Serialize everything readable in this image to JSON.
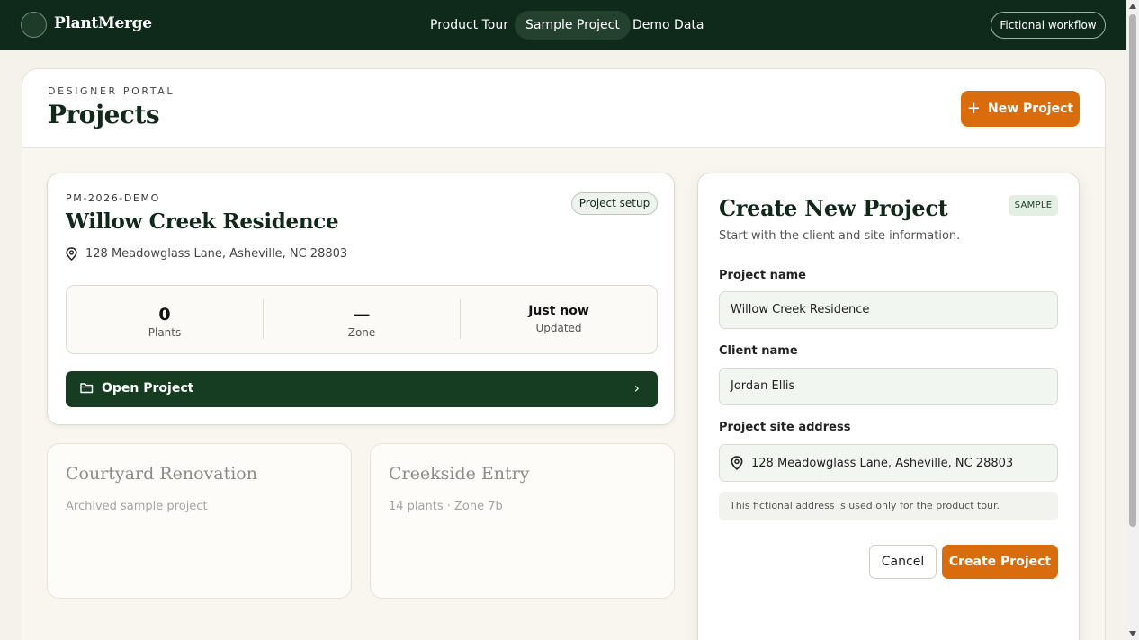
{
  "app": {
    "name": "PlantMerge",
    "nav": [
      "Product Tour",
      "Sample Project",
      "Demo Data"
    ],
    "active_nav": "Sample Project",
    "workflow_label": "Fictional workflow"
  },
  "header": {
    "eyebrow": "DESIGNER PORTAL",
    "title": "Projects",
    "new_project_label": "New Project"
  },
  "project": {
    "code": "PM-2026-DEMO",
    "status_badge": "Project setup",
    "name": "Willow Creek Residence",
    "address": "128 Meadowglass Lane, Asheville, NC 28803",
    "stats": [
      {
        "value": "0",
        "label": "Plants"
      },
      {
        "value": "—",
        "label": "Zone"
      },
      {
        "value": "Just now",
        "label": "Updated"
      }
    ],
    "open_label": "Open Project"
  },
  "other_projects": [
    {
      "name": "Courtyard Renovation",
      "summary": "Archived sample project"
    },
    {
      "name": "Creekside Entry",
      "summary": "14 plants · Zone 7b"
    }
  ],
  "form": {
    "title": "Create New Project",
    "badge": "SAMPLE",
    "subtitle": "Start with the client and site information.",
    "project_name_label": "Project name",
    "project_name_value": "Willow Creek Residence",
    "client_name_label": "Client name",
    "client_name_value": "Jordan Ellis",
    "address_label": "Project site address",
    "address_value": "128 Meadowglass Lane, Asheville, NC 28803",
    "note": "This fictional address is used only for the product tour.",
    "cancel_label": "Cancel",
    "create_label": "Create Project"
  },
  "colors": {
    "topbar": "#0f2a1a",
    "accent": "#d96d0d",
    "primary_dark": "#163d22",
    "background": "#f4f2ea"
  }
}
